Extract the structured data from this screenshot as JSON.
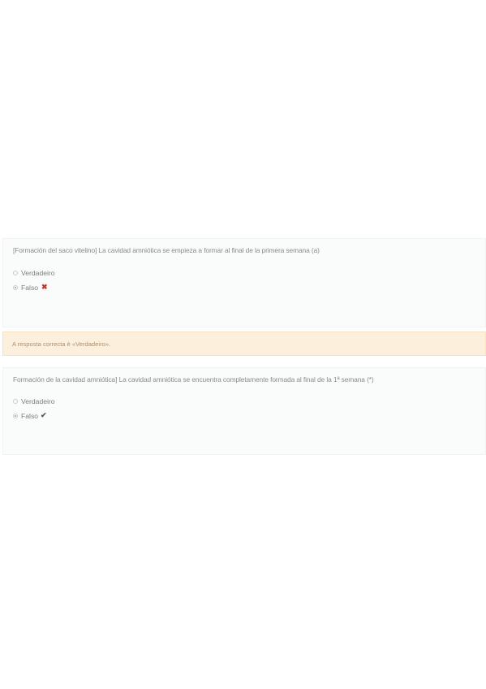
{
  "questions": [
    {
      "text": "[Formación del saco vitelino] La cavidad amniótica se empieza a formar al final de la primera semana (a)",
      "options": [
        {
          "label": "Verdadeiro",
          "selected": false
        },
        {
          "label": "Falso",
          "selected": true
        }
      ],
      "result_icon": "cross-icon",
      "result_glyph": "✖"
    },
    {
      "text": "Formación de la cavidad amniótica] La cavidad amniótica se encuentra completamente formada al final de la 1ª semana (*)",
      "options": [
        {
          "label": "Verdadeiro",
          "selected": false
        },
        {
          "label": "Falso",
          "selected": true
        }
      ],
      "result_icon": "check-icon",
      "result_glyph": "✔"
    }
  ],
  "feedback": {
    "text": "A resposta correcta é «Verdadeiro»."
  },
  "colors": {
    "wrong": "#c0392b",
    "feedback_bg": "#fcefdc"
  }
}
